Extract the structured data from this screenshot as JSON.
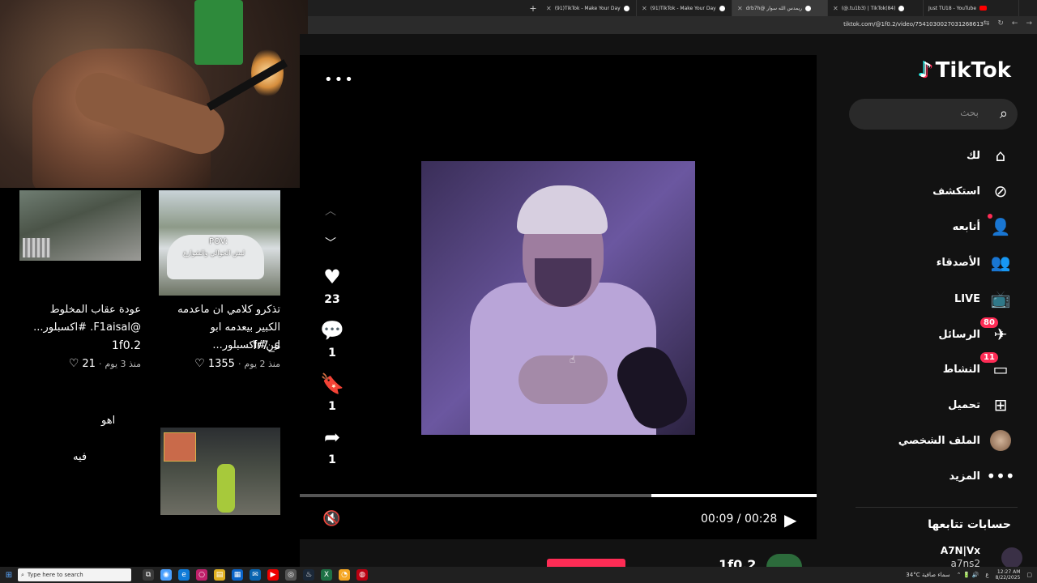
{
  "browser": {
    "tabs": [
      {
        "label": "(91)TikTok - Make Your Day",
        "icon": "tiktok-icon",
        "active": false
      },
      {
        "label": "(91)TikTok - Make Your Day",
        "icon": "tiktok-icon",
        "active": false
      },
      {
        "label": "drb7h@ ريمدس الله سوار",
        "icon": "tiktok-icon",
        "active": true
      },
      {
        "label": "(@.tu1b3) | TikTok(84)",
        "icon": "tiktok-icon",
        "active": false
      },
      {
        "label": "Just TU18 - YouTube",
        "icon": "youtube-icon",
        "active": false
      }
    ],
    "new_tab": "+",
    "address": "tiktok.com/@1f0.2/video/7541030027031268613"
  },
  "feed": {
    "items": [
      {
        "caption": "عودة عقاب المخلوط @F1aisal. #اكسبلور...",
        "author": "1f0.2",
        "likes": "21",
        "age": "منذ 3 يوم"
      },
      {
        "caption": "تذكرو كلامي ان ماعدمه الكبير بيعدمه ابو لين#اكسبلور...",
        "author": "fr7_s",
        "likes": "1355",
        "age": "منذ 2 يوم"
      }
    ],
    "thumb_pov": "POV:",
    "thumb_pov_sub": "ليش الخوالي والشوارع",
    "text_aho": "اهو",
    "text_fih": "فيه"
  },
  "video": {
    "likes": "23",
    "comments": "1",
    "saves": "1",
    "shares": "1",
    "time": "00:09 / 00:28",
    "progress": 0.32,
    "author": "1f0.2"
  },
  "sidebar": {
    "logo": "TikTok",
    "search_placeholder": "بحث",
    "menu": [
      {
        "label": "لك",
        "icon": "home-icon"
      },
      {
        "label": "استكشف",
        "icon": "compass-icon"
      },
      {
        "label": "أتابعه",
        "icon": "following-icon"
      },
      {
        "label": "الأصدقاء",
        "icon": "friends-icon"
      },
      {
        "label": "LIVE",
        "icon": "live-icon"
      },
      {
        "label": "الرسائل",
        "icon": "messages-icon",
        "badge": "80"
      },
      {
        "label": "النشاط",
        "icon": "activity-icon",
        "badge": "11"
      },
      {
        "label": "تحميل",
        "icon": "upload-icon"
      },
      {
        "label": "الملف الشخصي",
        "icon": "profile-avatar"
      },
      {
        "label": "المزيد",
        "icon": "more-icon"
      }
    ],
    "following_heading": "حسابات تتابعها",
    "following_user": "A7N|Vx",
    "following_user_sub": "a7ns2"
  },
  "taskbar": {
    "search_placeholder": "Type here to search",
    "weather": "34°C  سماء صافية",
    "time": "12:27 AM",
    "date": "8/22/2025",
    "lang": "ع"
  }
}
